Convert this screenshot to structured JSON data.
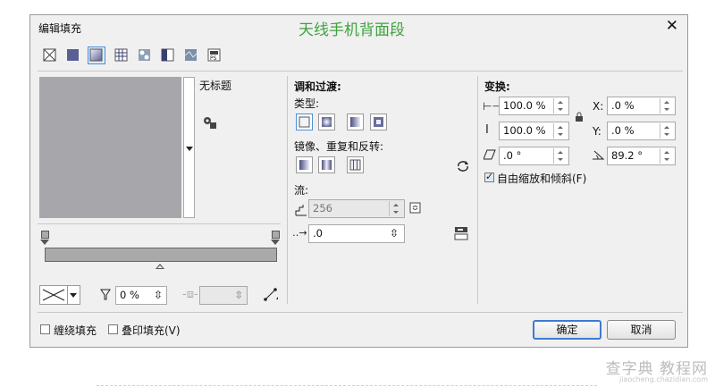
{
  "window": {
    "title": "编辑填充",
    "overlay_title": "天线手机背面段",
    "close_label": "✕"
  },
  "fill_types": [
    {
      "name": "no-fill"
    },
    {
      "name": "uniform-fill"
    },
    {
      "name": "fountain-fill",
      "selected": true
    },
    {
      "name": "vector-pattern-fill"
    },
    {
      "name": "bitmap-pattern-fill"
    },
    {
      "name": "two-color-pattern-fill"
    },
    {
      "name": "texture-fill"
    },
    {
      "name": "postscript-fill"
    }
  ],
  "preset": {
    "name": "无标题"
  },
  "blend": {
    "heading": "调和过渡:",
    "type_label": "类型:",
    "mirror_label": "镜像、重复和反转:",
    "flow_label": "流:",
    "steps_value": "256",
    "acceleration_value": ".0"
  },
  "transform": {
    "heading": "变换:",
    "width_value": "100.0 %",
    "height_value": "100.0 %",
    "x_label": "X:",
    "x_value": ".0 %",
    "y_label": "Y:",
    "y_value": ".0 %",
    "skew_value": ".0 °",
    "rotate_value": "89.2 °",
    "free_scale_label": "自由缩放和倾斜(F)",
    "free_scale_checked": true
  },
  "node": {
    "position_value": "0 %"
  },
  "bottom": {
    "wrap_fill_label": "缠绕填充",
    "overprint_label": "叠印填充(V)",
    "ok_label": "确定",
    "cancel_label": "取消"
  },
  "watermark": {
    "text": "查字典 教程网",
    "url": "jiaocheng.chazidian.com"
  },
  "colors": {
    "accent": "#4a90d9",
    "preview_gray": "#a7a7ab",
    "title_green": "#3fa23f"
  }
}
